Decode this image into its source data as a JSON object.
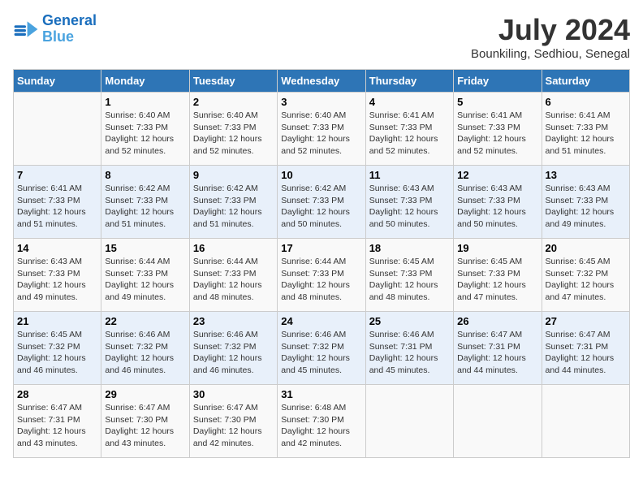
{
  "header": {
    "logo_line1": "General",
    "logo_line2": "Blue",
    "month_year": "July 2024",
    "location": "Bounkiling, Sedhiou, Senegal"
  },
  "days_of_week": [
    "Sunday",
    "Monday",
    "Tuesday",
    "Wednesday",
    "Thursday",
    "Friday",
    "Saturday"
  ],
  "weeks": [
    [
      {
        "day": "",
        "info": ""
      },
      {
        "day": "1",
        "info": "Sunrise: 6:40 AM\nSunset: 7:33 PM\nDaylight: 12 hours\nand 52 minutes."
      },
      {
        "day": "2",
        "info": "Sunrise: 6:40 AM\nSunset: 7:33 PM\nDaylight: 12 hours\nand 52 minutes."
      },
      {
        "day": "3",
        "info": "Sunrise: 6:40 AM\nSunset: 7:33 PM\nDaylight: 12 hours\nand 52 minutes."
      },
      {
        "day": "4",
        "info": "Sunrise: 6:41 AM\nSunset: 7:33 PM\nDaylight: 12 hours\nand 52 minutes."
      },
      {
        "day": "5",
        "info": "Sunrise: 6:41 AM\nSunset: 7:33 PM\nDaylight: 12 hours\nand 52 minutes."
      },
      {
        "day": "6",
        "info": "Sunrise: 6:41 AM\nSunset: 7:33 PM\nDaylight: 12 hours\nand 51 minutes."
      }
    ],
    [
      {
        "day": "7",
        "info": "Sunrise: 6:41 AM\nSunset: 7:33 PM\nDaylight: 12 hours\nand 51 minutes."
      },
      {
        "day": "8",
        "info": "Sunrise: 6:42 AM\nSunset: 7:33 PM\nDaylight: 12 hours\nand 51 minutes."
      },
      {
        "day": "9",
        "info": "Sunrise: 6:42 AM\nSunset: 7:33 PM\nDaylight: 12 hours\nand 51 minutes."
      },
      {
        "day": "10",
        "info": "Sunrise: 6:42 AM\nSunset: 7:33 PM\nDaylight: 12 hours\nand 50 minutes."
      },
      {
        "day": "11",
        "info": "Sunrise: 6:43 AM\nSunset: 7:33 PM\nDaylight: 12 hours\nand 50 minutes."
      },
      {
        "day": "12",
        "info": "Sunrise: 6:43 AM\nSunset: 7:33 PM\nDaylight: 12 hours\nand 50 minutes."
      },
      {
        "day": "13",
        "info": "Sunrise: 6:43 AM\nSunset: 7:33 PM\nDaylight: 12 hours\nand 49 minutes."
      }
    ],
    [
      {
        "day": "14",
        "info": "Sunrise: 6:43 AM\nSunset: 7:33 PM\nDaylight: 12 hours\nand 49 minutes."
      },
      {
        "day": "15",
        "info": "Sunrise: 6:44 AM\nSunset: 7:33 PM\nDaylight: 12 hours\nand 49 minutes."
      },
      {
        "day": "16",
        "info": "Sunrise: 6:44 AM\nSunset: 7:33 PM\nDaylight: 12 hours\nand 48 minutes."
      },
      {
        "day": "17",
        "info": "Sunrise: 6:44 AM\nSunset: 7:33 PM\nDaylight: 12 hours\nand 48 minutes."
      },
      {
        "day": "18",
        "info": "Sunrise: 6:45 AM\nSunset: 7:33 PM\nDaylight: 12 hours\nand 48 minutes."
      },
      {
        "day": "19",
        "info": "Sunrise: 6:45 AM\nSunset: 7:33 PM\nDaylight: 12 hours\nand 47 minutes."
      },
      {
        "day": "20",
        "info": "Sunrise: 6:45 AM\nSunset: 7:32 PM\nDaylight: 12 hours\nand 47 minutes."
      }
    ],
    [
      {
        "day": "21",
        "info": "Sunrise: 6:45 AM\nSunset: 7:32 PM\nDaylight: 12 hours\nand 46 minutes."
      },
      {
        "day": "22",
        "info": "Sunrise: 6:46 AM\nSunset: 7:32 PM\nDaylight: 12 hours\nand 46 minutes."
      },
      {
        "day": "23",
        "info": "Sunrise: 6:46 AM\nSunset: 7:32 PM\nDaylight: 12 hours\nand 46 minutes."
      },
      {
        "day": "24",
        "info": "Sunrise: 6:46 AM\nSunset: 7:32 PM\nDaylight: 12 hours\nand 45 minutes."
      },
      {
        "day": "25",
        "info": "Sunrise: 6:46 AM\nSunset: 7:31 PM\nDaylight: 12 hours\nand 45 minutes."
      },
      {
        "day": "26",
        "info": "Sunrise: 6:47 AM\nSunset: 7:31 PM\nDaylight: 12 hours\nand 44 minutes."
      },
      {
        "day": "27",
        "info": "Sunrise: 6:47 AM\nSunset: 7:31 PM\nDaylight: 12 hours\nand 44 minutes."
      }
    ],
    [
      {
        "day": "28",
        "info": "Sunrise: 6:47 AM\nSunset: 7:31 PM\nDaylight: 12 hours\nand 43 minutes."
      },
      {
        "day": "29",
        "info": "Sunrise: 6:47 AM\nSunset: 7:30 PM\nDaylight: 12 hours\nand 43 minutes."
      },
      {
        "day": "30",
        "info": "Sunrise: 6:47 AM\nSunset: 7:30 PM\nDaylight: 12 hours\nand 42 minutes."
      },
      {
        "day": "31",
        "info": "Sunrise: 6:48 AM\nSunset: 7:30 PM\nDaylight: 12 hours\nand 42 minutes."
      },
      {
        "day": "",
        "info": ""
      },
      {
        "day": "",
        "info": ""
      },
      {
        "day": "",
        "info": ""
      }
    ]
  ]
}
